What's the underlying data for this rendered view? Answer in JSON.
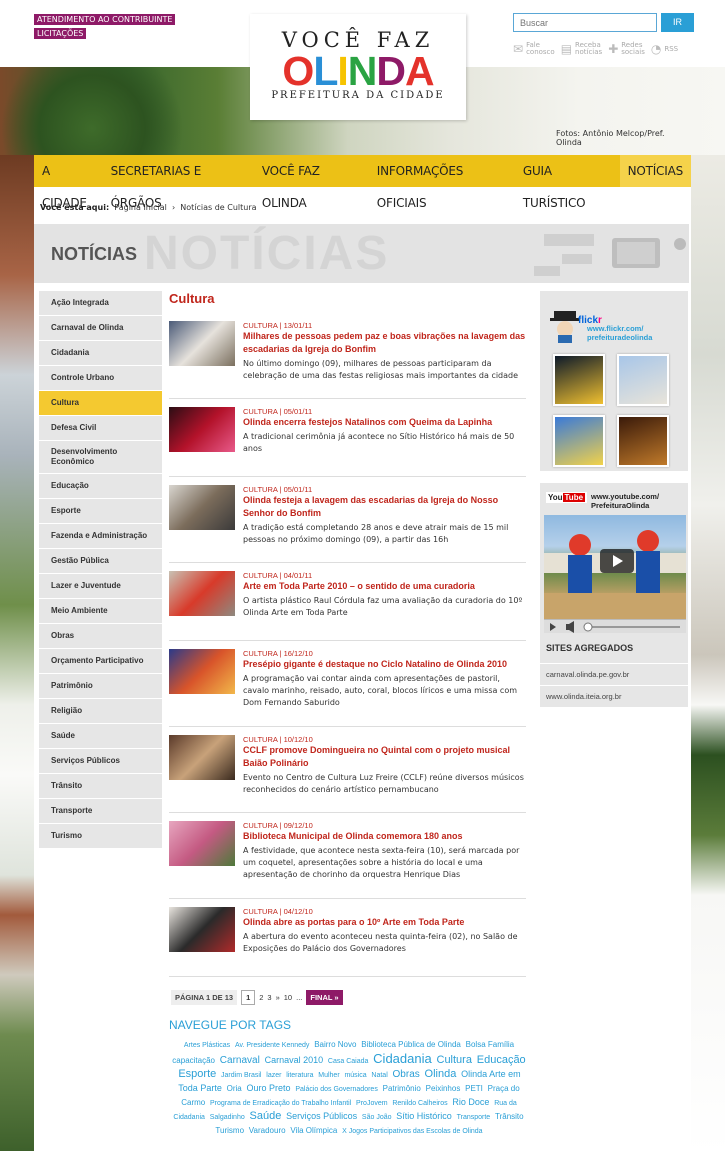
{
  "header": {
    "toplinks": [
      "ATENDIMENTO AO CONTRIBUINTE",
      "LICITAÇÕES"
    ],
    "logo": {
      "line1": "VOCÊ FAZ",
      "line2_letters": [
        "O",
        "L",
        "I",
        "N",
        "D",
        "A"
      ],
      "line2_colors": [
        "#e4322b",
        "#2a8fd6",
        "#f6c300",
        "#2aa343",
        "#8e1a67",
        "#e4322b"
      ],
      "line3": "PREFEITURA DA CIDADE"
    },
    "search_placeholder": "Buscar",
    "search_button": "IR",
    "social": [
      {
        "icon": "envelope-icon",
        "line1": "Fale",
        "line2": "conosco"
      },
      {
        "icon": "document-icon",
        "line1": "Receba",
        "line2": "notícias"
      },
      {
        "icon": "network-icon",
        "line1": "Redes",
        "line2": "sociais"
      },
      {
        "icon": "rss-icon",
        "line1": "RSS",
        "line2": ""
      }
    ],
    "photo_credit": "Fotos:   Antônio Melcop/Pref. Olinda"
  },
  "nav": [
    {
      "label": "A CIDADE",
      "active": false
    },
    {
      "label": "SECRETARIAS E ÓRGÃOS",
      "active": false
    },
    {
      "label": "VOCÊ FAZ OLINDA",
      "active": false
    },
    {
      "label": "INFORMAÇÕES OFICIAIS",
      "active": false
    },
    {
      "label": "GUIA TURÍSTICO",
      "active": false
    },
    {
      "label": "NOTÍCIAS",
      "active": true
    }
  ],
  "breadcrumb": {
    "label": "Você está aqui:",
    "items": [
      "Página Inicial",
      "›",
      "Notícias de Cultura"
    ]
  },
  "banner": {
    "title": "NOTÍCIAS",
    "watermark": "NOTÍCIAS"
  },
  "sidebar": [
    "Ação Integrada",
    "Carnaval de Olinda",
    "Cidadania",
    "Controle Urbano",
    "Cultura",
    "Defesa Civil",
    "Desenvolvimento Econômico",
    "Educação",
    "Esporte",
    "Fazenda e Administração",
    "Gestão Pública",
    "Lazer e Juventude",
    "Meio Ambiente",
    "Obras",
    "Orçamento Participativo",
    "Patrimônio",
    "Religião",
    "Saúde",
    "Serviços Públicos",
    "Trânsito",
    "Transporte",
    "Turismo"
  ],
  "sidebar_active": "Cultura",
  "content": {
    "title": "Cultura",
    "news": [
      {
        "date": "CULTURA | 13/01/11",
        "title": "Milhares de pessoas pedem paz e boas vibrações na lavagem das escadarias da Igreja do Bonfim",
        "desc": "No último domingo (09), milhares de pessoas participaram da celebração de uma das festas religiosas mais importantes da cidade",
        "thumb": [
          "#4a5a78",
          "#e6e2dc",
          "#7a6f5e"
        ]
      },
      {
        "date": "CULTURA | 05/01/11",
        "title": "Olinda encerra festejos Natalinos com Queima da Lapinha",
        "desc": "A tradicional cerimônia já acontece no Sítio Histórico há mais de 50 anos",
        "thumb": [
          "#2b0d14",
          "#b3122a",
          "#e85a8a"
        ]
      },
      {
        "date": "CULTURA | 05/01/11",
        "title": "Olinda festeja a lavagem das escadarias da Igreja do Nosso Senhor do Bonfim",
        "desc": "A tradição está completando 28 anos e deve atrair mais de 15 mil pessoas no próximo domingo (09), a partir das 16h",
        "thumb": [
          "#d9d6d0",
          "#7b6c5b",
          "#3b3a3a"
        ]
      },
      {
        "date": "CULTURA | 04/01/11",
        "title": "Arte em Toda Parte 2010 – o sentido de uma curadoria",
        "desc": "O artista plástico Raul Córdula faz uma avaliação da curadoria do 10º Olinda Arte em Toda Parte",
        "thumb": [
          "#c8c2b4",
          "#d83a2a",
          "#8e8a80"
        ]
      },
      {
        "date": "CULTURA | 16/12/10",
        "title": "Presépio gigante é destaque no Ciclo Natalino de Olinda 2010",
        "desc": "A programação vai contar ainda com apresentações de pastoril, cavalo marinho, reisado, auto, coral, blocos líricos e uma missa com Dom Fernando Saburido",
        "thumb": [
          "#2a3a8a",
          "#d8542a",
          "#f2b84a"
        ]
      },
      {
        "date": "CULTURA | 10/12/10",
        "title": "CCLF promove Domingueira no Quintal com o projeto musical Baião Polinário",
        "desc": "Evento no Centro de Cultura Luz Freire (CCLF) reúne diversos músicos reconhecidos do cenário artístico pernambucano",
        "thumb": [
          "#5a3a2a",
          "#c8a27a",
          "#3a2a1e"
        ]
      },
      {
        "date": "CULTURA | 09/12/10",
        "title": "Biblioteca Municipal de Olinda comemora 180 anos",
        "desc": "A festividade, que acontece nesta sexta-feira (10), será marcada por um coquetel, apresentações sobre a história do local e uma apresentação de chorinho da orquestra Henrique Dias",
        "thumb": [
          "#e7a6bf",
          "#c45a82",
          "#4e7a3a"
        ]
      },
      {
        "date": "CULTURA | 04/12/10",
        "title": "Olinda abre as portas para o 10º Arte em Toda Parte",
        "desc": "A abertura do evento aconteceu nesta quinta-feira (02), no Salão de Exposições do Palácio dos Governadores",
        "thumb": [
          "#e8e4de",
          "#2a2a2a",
          "#b02a2a"
        ]
      }
    ],
    "pager": {
      "label": "PÁGINA 1 DE 13",
      "pages": [
        "1",
        "2",
        "3",
        "»",
        "10",
        "..."
      ],
      "final": "FINAL »"
    },
    "tags_title": "NAVEGUE POR TAGS",
    "tags": [
      {
        "t": "Artes Plásticas",
        "s": 1
      },
      {
        "t": "Av. Presidente Kennedy",
        "s": 1
      },
      {
        "t": "Bairro Novo",
        "s": 2
      },
      {
        "t": "Biblioteca Pública de Olinda",
        "s": 2
      },
      {
        "t": "Bolsa Família",
        "s": 2
      },
      {
        "t": "capacitação",
        "s": 2
      },
      {
        "t": "Carnaval",
        "s": 4
      },
      {
        "t": "Carnaval 2010",
        "s": 3
      },
      {
        "t": "Casa Caiada",
        "s": 1
      },
      {
        "t": "Cidadania",
        "s": 6
      },
      {
        "t": "Cultura",
        "s": 5
      },
      {
        "t": "Educação",
        "s": 5
      },
      {
        "t": "Esporte",
        "s": 5
      },
      {
        "t": "Jardim Brasil",
        "s": 1
      },
      {
        "t": "lazer",
        "s": 1
      },
      {
        "t": "literatura",
        "s": 1
      },
      {
        "t": "Mulher",
        "s": 1
      },
      {
        "t": "música",
        "s": 1
      },
      {
        "t": "Natal",
        "s": 1
      },
      {
        "t": "Obras",
        "s": 4
      },
      {
        "t": "Olinda",
        "s": 5
      },
      {
        "t": "Olinda Arte em Toda Parte",
        "s": 3
      },
      {
        "t": "Oria",
        "s": 2
      },
      {
        "t": "Ouro Preto",
        "s": 3
      },
      {
        "t": "Palácio dos Governadores",
        "s": 1
      },
      {
        "t": "Patrimônio",
        "s": 2
      },
      {
        "t": "Peixinhos",
        "s": 2
      },
      {
        "t": "PETI",
        "s": 2
      },
      {
        "t": "Praça do Carmo",
        "s": 2
      },
      {
        "t": "Programa de Erradicação do Trabalho Infantil",
        "s": 1
      },
      {
        "t": "ProJovem",
        "s": 1
      },
      {
        "t": "Renildo Calheiros",
        "s": 1
      },
      {
        "t": "Rio Doce",
        "s": 3
      },
      {
        "t": "Rua da Cidadania",
        "s": 1
      },
      {
        "t": "Salgadinho",
        "s": 1
      },
      {
        "t": "Saúde",
        "s": 5
      },
      {
        "t": "Serviços Públicos",
        "s": 3
      },
      {
        "t": "São João",
        "s": 1
      },
      {
        "t": "Sítio Histórico",
        "s": 3
      },
      {
        "t": "Transporte",
        "s": 1
      },
      {
        "t": "Trânsito",
        "s": 2
      },
      {
        "t": "Turismo",
        "s": 2
      },
      {
        "t": "Varadouro",
        "s": 2
      },
      {
        "t": "Vila Olímpica",
        "s": 2
      },
      {
        "t": "X Jogos Participativos das Escolas de Olinda",
        "s": 1
      }
    ]
  },
  "right": {
    "flickr_logo": [
      "flick",
      "r"
    ],
    "flickr_url": [
      "www.flickr.com/",
      "prefeituradeolinda"
    ],
    "flickr_photos": [
      [
        "#0d1a2a",
        "#f0c030"
      ],
      [
        "#a8c6e8",
        "#e8e4da"
      ],
      [
        "#3a7ad8",
        "#f2d24a"
      ],
      [
        "#3a1a0a",
        "#c07a2a"
      ]
    ],
    "youtube_logo": [
      "You",
      "Tube"
    ],
    "youtube_url": [
      "www.youtube.com/",
      "PrefeituraOlinda"
    ],
    "sites_title": "SITES AGREGADOS",
    "sites": [
      "carnaval.olinda.pe.gov.br",
      "www.olinda.iteia.org.br"
    ]
  },
  "colors": {
    "accent": "#ecc116",
    "brand": "#8e1a67",
    "link": "#c0261c",
    "tags": "#2a9fd6"
  }
}
